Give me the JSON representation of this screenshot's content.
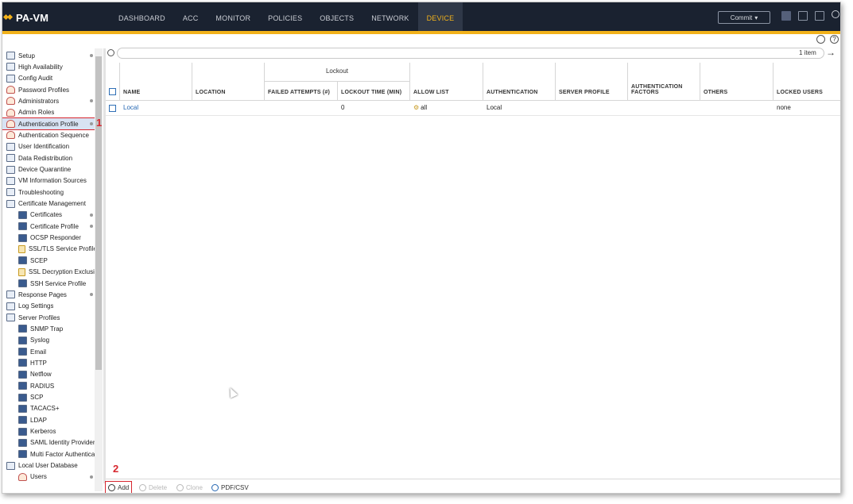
{
  "app": {
    "title": "PA-VM"
  },
  "nav": [
    "DASHBOARD",
    "ACC",
    "MONITOR",
    "POLICIES",
    "OBJECTS",
    "NETWORK",
    "DEVICE"
  ],
  "nav_active": "DEVICE",
  "commit_label": "Commit",
  "sidebar": [
    {
      "label": "Setup",
      "indent": 0,
      "dot": true
    },
    {
      "label": "High Availability",
      "indent": 0
    },
    {
      "label": "Config Audit",
      "indent": 0
    },
    {
      "label": "Password Profiles",
      "indent": 0
    },
    {
      "label": "Administrators",
      "indent": 0,
      "dot": true
    },
    {
      "label": "Admin Roles",
      "indent": 0
    },
    {
      "label": "Authentication Profile",
      "indent": 0,
      "dot": true,
      "selected": true
    },
    {
      "label": "Authentication Sequence",
      "indent": 0
    },
    {
      "label": "User Identification",
      "indent": 0
    },
    {
      "label": "Data Redistribution",
      "indent": 0
    },
    {
      "label": "Device Quarantine",
      "indent": 0
    },
    {
      "label": "VM Information Sources",
      "indent": 0
    },
    {
      "label": "Troubleshooting",
      "indent": 0
    },
    {
      "label": "Certificate Management",
      "indent": 0
    },
    {
      "label": "Certificates",
      "indent": 1,
      "dot": true
    },
    {
      "label": "Certificate Profile",
      "indent": 1,
      "dot": true
    },
    {
      "label": "OCSP Responder",
      "indent": 1
    },
    {
      "label": "SSL/TLS Service Profile",
      "indent": 1
    },
    {
      "label": "SCEP",
      "indent": 1
    },
    {
      "label": "SSL Decryption Exclusion",
      "indent": 1
    },
    {
      "label": "SSH Service Profile",
      "indent": 1
    },
    {
      "label": "Response Pages",
      "indent": 0,
      "dot": true
    },
    {
      "label": "Log Settings",
      "indent": 0
    },
    {
      "label": "Server Profiles",
      "indent": 0
    },
    {
      "label": "SNMP Trap",
      "indent": 1
    },
    {
      "label": "Syslog",
      "indent": 1
    },
    {
      "label": "Email",
      "indent": 1
    },
    {
      "label": "HTTP",
      "indent": 1
    },
    {
      "label": "Netflow",
      "indent": 1
    },
    {
      "label": "RADIUS",
      "indent": 1
    },
    {
      "label": "SCP",
      "indent": 1
    },
    {
      "label": "TACACS+",
      "indent": 1
    },
    {
      "label": "LDAP",
      "indent": 1
    },
    {
      "label": "Kerberos",
      "indent": 1
    },
    {
      "label": "SAML Identity Provider",
      "indent": 1
    },
    {
      "label": "Multi Factor Authentication",
      "indent": 1
    },
    {
      "label": "Local User Database",
      "indent": 0
    },
    {
      "label": "Users",
      "indent": 1,
      "dot": true
    }
  ],
  "filter": {
    "count": "1 item"
  },
  "table": {
    "group_header": "Lockout",
    "columns": [
      "NAME",
      "LOCATION",
      "FAILED ATTEMPTS (#)",
      "LOCKOUT TIME (MIN)",
      "ALLOW LIST",
      "AUTHENTICATION",
      "SERVER PROFILE",
      "AUTHENTICATION FACTORS",
      "OTHERS",
      "LOCKED USERS"
    ],
    "rows": [
      {
        "name": "Local",
        "location": "",
        "failed": "",
        "lockout": "0",
        "allow": "all",
        "auth": "Local",
        "server": "",
        "factors": "",
        "others": "",
        "locked": "none"
      }
    ]
  },
  "footer": {
    "add": "Add",
    "delete": "Delete",
    "clone": "Clone",
    "pdf": "PDF/CSV"
  },
  "annotations": {
    "one": "1",
    "two": "2"
  },
  "colors": {
    "accent": "#f2b21b",
    "topbar": "#1a2230",
    "highlight": "#d7262e",
    "link": "#2466b2"
  }
}
